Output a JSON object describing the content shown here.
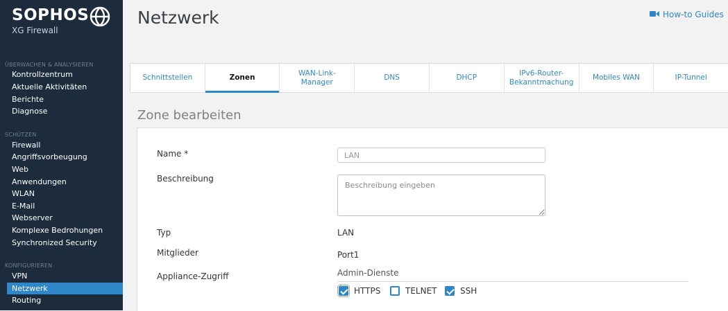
{
  "sidebar": {
    "brand": {
      "name": "SOPHOS",
      "product": "XG Firewall"
    },
    "sections": [
      {
        "title": "ÜBERWACHEN & ANALYSIEREN",
        "items": [
          "Kontrollzentrum",
          "Aktuelle Aktivitäten",
          "Berichte",
          "Diagnose"
        ]
      },
      {
        "title": "SCHÜTZEN",
        "items": [
          "Firewall",
          "Angriffsvorbeugung",
          "Web",
          "Anwendungen",
          "WLAN",
          "E-Mail",
          "Webserver",
          "Komplexe Bedrohungen",
          "Synchronized Security"
        ]
      },
      {
        "title": "KONFIGURIEREN",
        "items": [
          "VPN",
          "Netzwerk",
          "Routing"
        ]
      }
    ],
    "active_item": "Netzwerk"
  },
  "header": {
    "title": "Netzwerk",
    "howto": "How-to Guides"
  },
  "tabs": [
    {
      "label": "Schnittstellen",
      "active": false
    },
    {
      "label": "Zonen",
      "active": true
    },
    {
      "label": "WAN-Link-Manager",
      "active": false
    },
    {
      "label": "DNS",
      "active": false
    },
    {
      "label": "DHCP",
      "active": false
    },
    {
      "label": "IPv6-Router-Bekanntmachung",
      "active": false
    },
    {
      "label": "Mobiles WAN",
      "active": false
    },
    {
      "label": "IP-Tunnel",
      "active": false
    }
  ],
  "form": {
    "section_title": "Zone bearbeiten",
    "name_label": "Name *",
    "name_value": "LAN",
    "description_label": "Beschreibung",
    "description_placeholder": "Beschreibung eingeben",
    "type_label": "Typ",
    "type_value": "LAN",
    "members_label": "Mitglieder",
    "members_value": "Port1",
    "appliance_access_label": "Appliance-Zugriff",
    "admin_services_label": "Admin-Dienste",
    "admin_services": [
      {
        "label": "HTTPS",
        "checked": true
      },
      {
        "label": "TELNET",
        "checked": false
      },
      {
        "label": "SSH",
        "checked": true
      }
    ]
  },
  "colors": {
    "sidebar_bg": "#1c2c3c",
    "accent": "#2e87c8",
    "page_bg": "#f2f2f2"
  }
}
